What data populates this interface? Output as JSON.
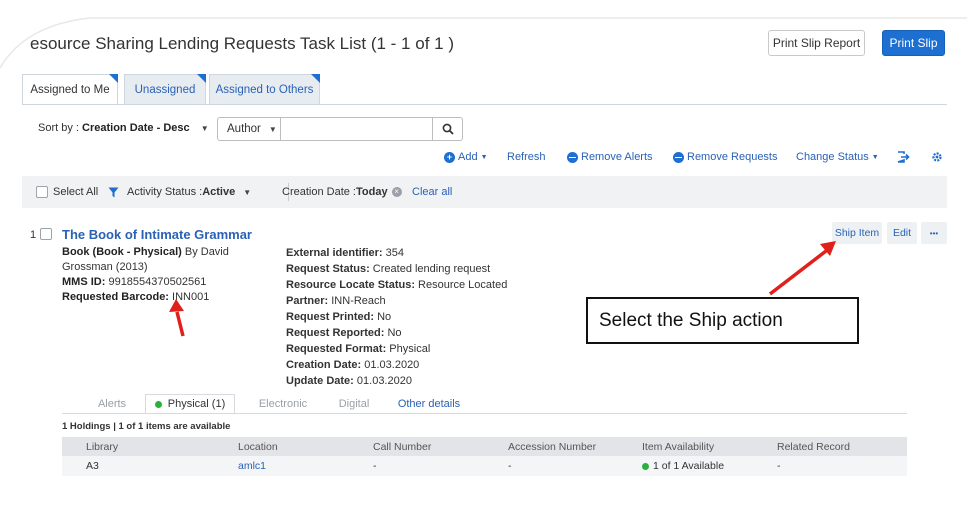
{
  "header": {
    "title": "esource Sharing Lending Requests Task List (1 - 1 of 1 )",
    "print_slip_report": "Print Slip Report",
    "print_slip": "Print Slip"
  },
  "tabs": [
    {
      "label": "Assigned to Me",
      "active": true
    },
    {
      "label": "Unassigned",
      "active": false
    },
    {
      "label": "Assigned to Others",
      "active": false
    }
  ],
  "toolbar": {
    "sort_prefix": "Sort by : ",
    "sort_value": "Creation Date - Desc",
    "search_field": "Author",
    "search_value": "",
    "actions": {
      "add": "Add",
      "refresh": "Refresh",
      "remove_alerts": "Remove Alerts",
      "remove_requests": "Remove Requests",
      "change_status": "Change Status"
    }
  },
  "filters": {
    "select_all": "Select All",
    "activity_status_label": "Activity Status : ",
    "activity_status_value": "Active",
    "creation_date_label": "Creation Date : ",
    "creation_date_value": "Today",
    "clear_all": "Clear all"
  },
  "record": {
    "number": "1",
    "title": "The Book of Intimate Grammar",
    "format_label": "Book (Book - Physical)",
    "author_text": " By David Grossman (2013)",
    "mms_label": "MMS ID: ",
    "mms_value": "9918554370502561",
    "barcode_label": "Requested Barcode: ",
    "barcode_value": "INN001",
    "details": [
      {
        "label": "External identifier: ",
        "value": "354"
      },
      {
        "label": "Request Status: ",
        "value": "Created lending request"
      },
      {
        "label": "Resource Locate Status: ",
        "value": "Resource Located"
      },
      {
        "label": "Partner: ",
        "value": "INN-Reach"
      },
      {
        "label": "Request Printed: ",
        "value": "No"
      },
      {
        "label": "Request Reported: ",
        "value": "No"
      },
      {
        "label": "Requested Format: ",
        "value": "Physical"
      },
      {
        "label": "Creation Date: ",
        "value": "01.03.2020"
      },
      {
        "label": "Update Date: ",
        "value": "01.03.2020"
      }
    ],
    "buttons": {
      "ship_item": "Ship Item",
      "edit": "Edit",
      "more": "•••"
    }
  },
  "callout": {
    "text": "Select the Ship action"
  },
  "subtabs": [
    {
      "label": "Alerts"
    },
    {
      "label": "Physical (1)"
    },
    {
      "label": "Electronic"
    },
    {
      "label": "Digital"
    },
    {
      "label": "Other details"
    }
  ],
  "holdings": {
    "summary": "1 Holdings | 1 of 1 items are available",
    "columns": [
      "Library",
      "Location",
      "Call Number",
      "Accession Number",
      "Item Availability",
      "Related Record"
    ],
    "row": {
      "library": "A3",
      "location": "amlc1",
      "call_number": "-",
      "accession_number": "-",
      "availability": "1 of 1 Available",
      "related_record": "-"
    }
  },
  "colors": {
    "accent": "#1d6fd1",
    "link": "#2a62b5",
    "arrow": "#e0201b",
    "available": "#2bb03c"
  }
}
